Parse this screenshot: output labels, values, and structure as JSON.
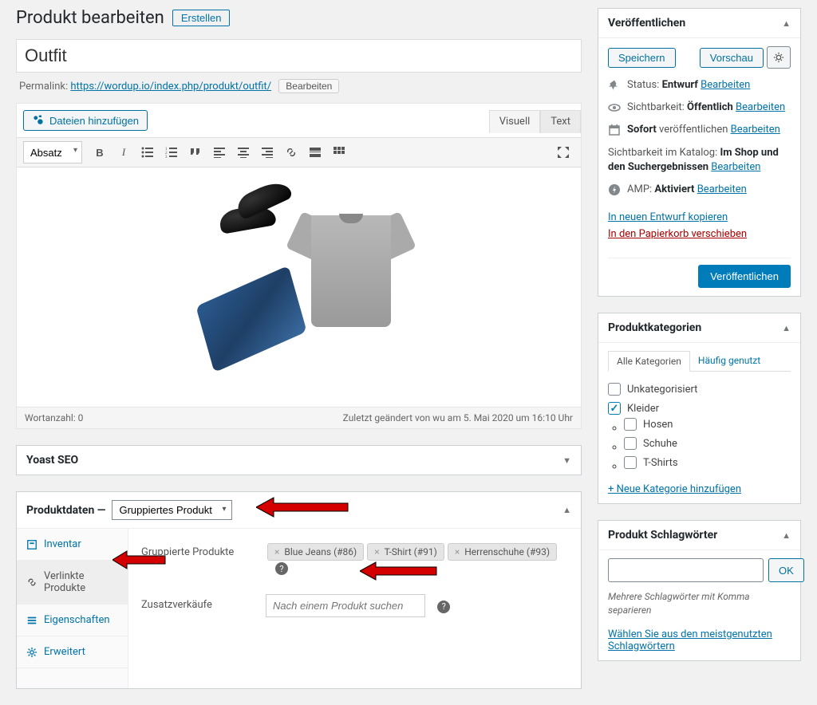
{
  "page": {
    "title": "Produkt bearbeiten",
    "create_btn": "Erstellen"
  },
  "title_field": {
    "value": "Outfit"
  },
  "permalink": {
    "label": "Permalink:",
    "url": "https://wordup.io/index.php/produkt/outfit/",
    "edit_btn": "Bearbeiten"
  },
  "editor": {
    "media_btn": "Dateien hinzufügen",
    "tab_visual": "Visuell",
    "tab_text": "Text",
    "format_select": "Absatz",
    "word_count_label": "Wortanzahl:",
    "word_count": "0",
    "last_edited": "Zuletzt geändert von wu am 5. Mai 2020 um 16:10 Uhr"
  },
  "yoast": {
    "title": "Yoast SEO"
  },
  "product_data": {
    "title": "Produktdaten",
    "type": "Gruppiertes Produkt",
    "tabs": {
      "inventory": "Inventar",
      "linked": "Verlinkte Produkte",
      "attributes": "Eigenschaften",
      "advanced": "Erweitert"
    },
    "grouped_label": "Gruppierte Produkte",
    "grouped_items": [
      "Blue Jeans (#86)",
      "T-Shirt (#91)",
      "Herrenschuhe (#93)"
    ],
    "upsell_label": "Zusatzverkäufe",
    "upsell_placeholder": "Nach einem Produkt suchen"
  },
  "publish": {
    "title": "Veröffentlichen",
    "save_btn": "Speichern",
    "preview_btn": "Vorschau",
    "status_label": "Status:",
    "status_value": "Entwurf",
    "visibility_label": "Sichtbarkeit:",
    "visibility_value": "Öffentlich",
    "schedule_prefix": "Sofort",
    "schedule_word": "veröffentlichen",
    "catalog_label": "Sichtbarkeit im Katalog:",
    "catalog_value": "Im Shop und den Suchergebnissen",
    "amp_label": "AMP:",
    "amp_value": "Aktiviert",
    "edit_link": "Bearbeiten",
    "copy_draft": "In neuen Entwurf kopieren",
    "trash": "In den Papierkorb verschieben",
    "publish_btn": "Veröffentlichen"
  },
  "categories": {
    "title": "Produktkategorien",
    "tab_all": "Alle Kategorien",
    "tab_freq": "Häufig genutzt",
    "items": [
      {
        "label": "Unkategorisiert",
        "checked": false
      },
      {
        "label": "Kleider",
        "checked": true,
        "children": [
          {
            "label": "Hosen",
            "checked": false
          },
          {
            "label": "Schuhe",
            "checked": false
          },
          {
            "label": "T-Shirts",
            "checked": false
          }
        ]
      }
    ],
    "add_new": "+ Neue Kategorie hinzufügen"
  },
  "tags": {
    "title": "Produkt Schlagwörter",
    "ok_btn": "OK",
    "hint": "Mehrere Schlagwörter mit Komma separieren",
    "choose_link": "Wählen Sie aus den meistgenutzten Schlagwörtern"
  }
}
